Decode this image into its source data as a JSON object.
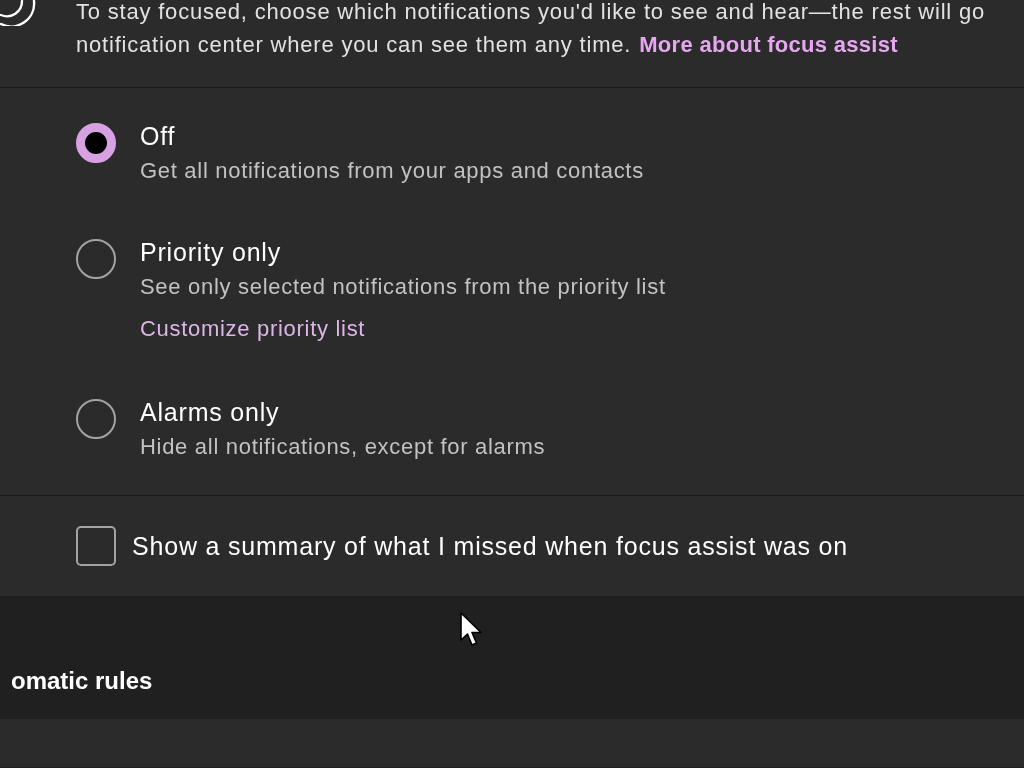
{
  "intro": {
    "lines": [
      "To stay focused, choose which notifications you'd like to see and hear—the rest will go",
      "notification center where you can see them any time."
    ],
    "link": "More about focus assist"
  },
  "focus_modes": [
    {
      "title": "Off",
      "description": "Get all notifications from your apps and contacts",
      "selected": true
    },
    {
      "title": "Priority only",
      "description": "See only selected notifications from the priority list",
      "link": "Customize priority list",
      "selected": false
    },
    {
      "title": "Alarms only",
      "description": "Hide all notifications, except for alarms",
      "selected": false
    }
  ],
  "summary_checkbox": {
    "label": "Show a summary of what I missed when focus assist was on",
    "checked": false
  },
  "automatic_rules": {
    "heading": "omatic rules"
  }
}
